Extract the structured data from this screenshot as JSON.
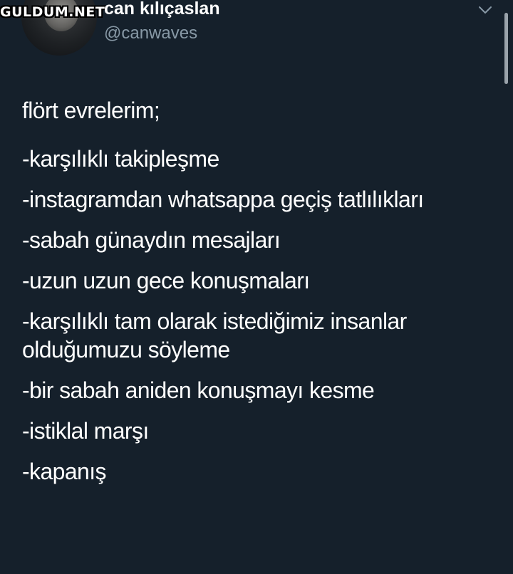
{
  "watermark": "GULDUM.NET",
  "user": {
    "display_name": "can kılıçaslan",
    "handle": "@canwaves"
  },
  "icons": {
    "menu": "chevron-down-icon"
  },
  "colors": {
    "background": "#15202b",
    "text": "#ffffff",
    "secondary_text": "#8899a6"
  },
  "tweet": {
    "heading": "flört evrelerim;",
    "items": [
      "-karşılıklı takipleşme",
      "-instagramdan whatsappa geçiş tatlılıkları",
      "-sabah günaydın mesajları",
      "-uzun uzun gece konuşmaları",
      "-karşılıklı tam olarak istediğimiz insanlar olduğumuzu söyleme",
      "-bir sabah aniden konuşmayı kesme",
      "-istiklal marşı",
      "-kapanış"
    ]
  }
}
